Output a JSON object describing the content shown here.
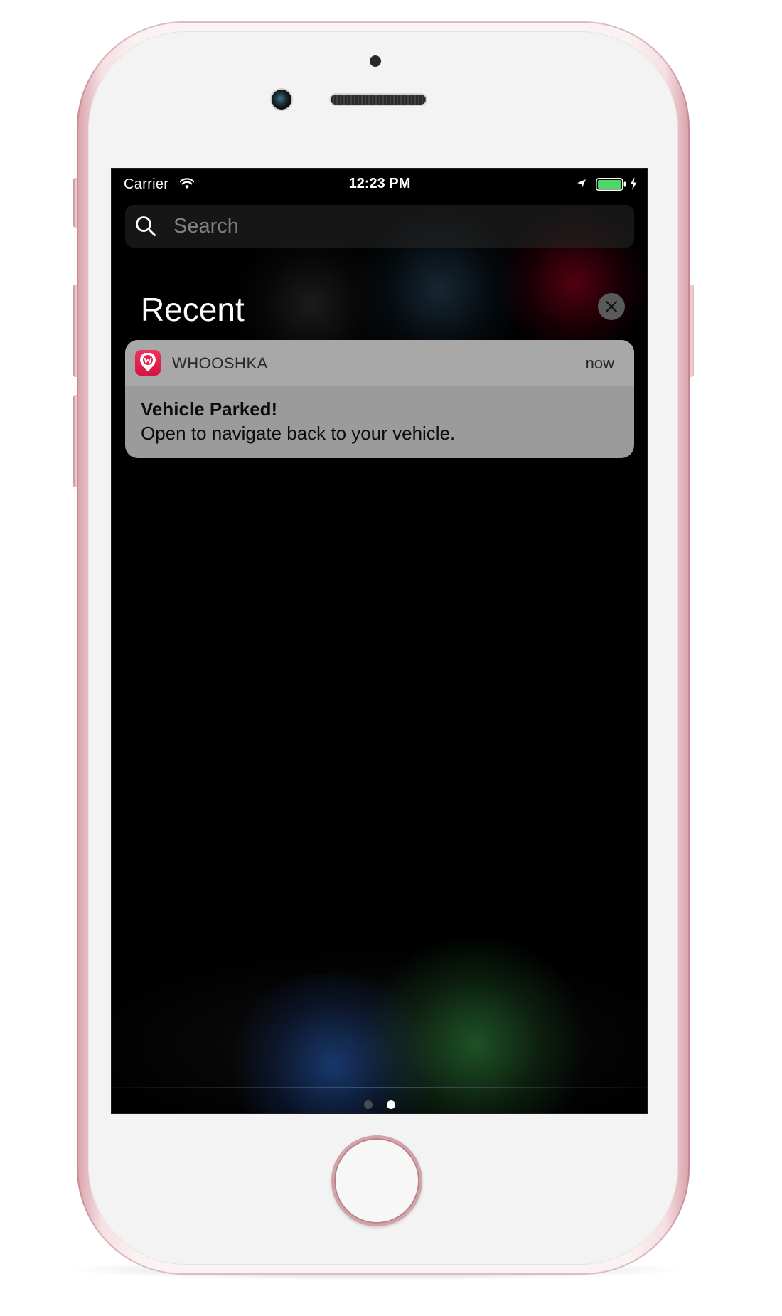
{
  "status_bar": {
    "carrier": "Carrier",
    "time": "12:23 PM",
    "icons": [
      "wifi-icon",
      "location-arrow-icon",
      "battery-icon",
      "charging-bolt-icon"
    ],
    "battery_color": "#4cd964"
  },
  "search": {
    "placeholder": "Search",
    "icon": "search-icon"
  },
  "recent": {
    "title": "Recent",
    "clear_icon": "close-icon"
  },
  "notifications": [
    {
      "app_name": "WHOOSHKA",
      "app_icon": "whooshka-app-icon",
      "app_icon_color": "#e8234f",
      "time": "now",
      "title": "Vehicle Parked!",
      "body": "Open to navigate back to your vehicle."
    }
  ],
  "page_indicator": {
    "total": 2,
    "current": 2
  },
  "device": {
    "finish_color": "#e5b6bd"
  }
}
